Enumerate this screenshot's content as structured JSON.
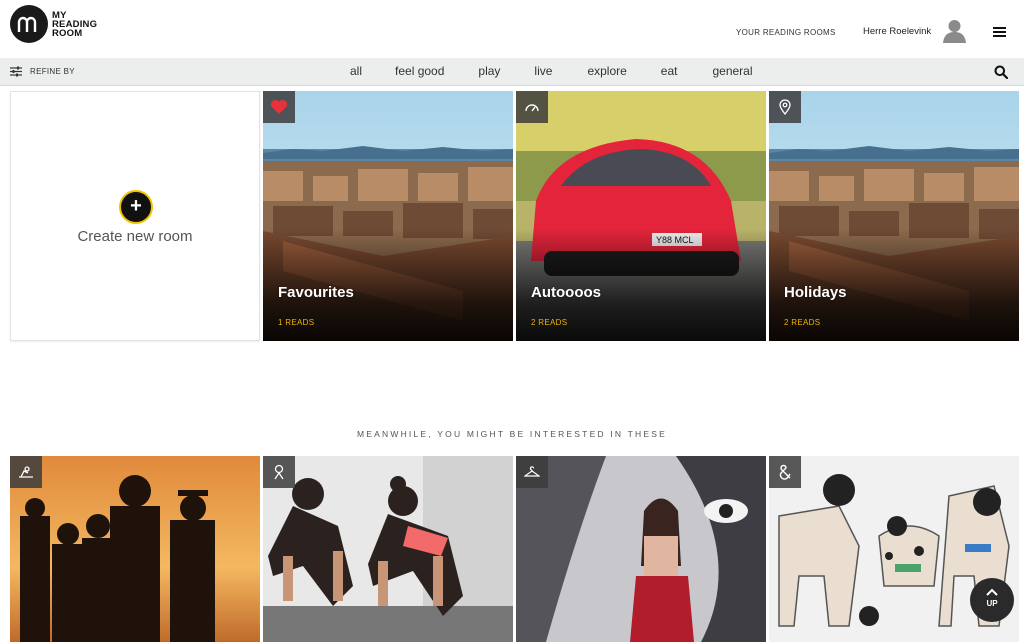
{
  "header": {
    "logo": [
      "MY",
      "READING",
      "ROOM"
    ],
    "nav_link": "YOUR READING ROOMS",
    "user_name": "Herre Roelevink"
  },
  "filterbar": {
    "refine_label": "REFINE BY",
    "categories": [
      "all",
      "feel good",
      "play",
      "live",
      "explore",
      "eat",
      "general"
    ]
  },
  "create_room": {
    "label": "Create new room",
    "icon": "plus-icon"
  },
  "rooms": [
    {
      "title": "Favourites",
      "reads": "1 READS",
      "icon": "heart-icon"
    },
    {
      "title": "Autoooos",
      "reads": "2 READS",
      "icon": "speedometer-icon"
    },
    {
      "title": "Holidays",
      "reads": "2 READS",
      "icon": "map-pin-icon"
    }
  ],
  "suggestions": {
    "title": "MEANWHILE, YOU MIGHT BE INTERESTED IN THESE",
    "items": [
      {
        "icon": "relax-icon"
      },
      {
        "icon": "fitness-icon"
      },
      {
        "icon": "hanger-icon"
      },
      {
        "icon": "ampersand-icon"
      }
    ]
  },
  "up_button": {
    "label": "UP"
  },
  "colors": {
    "accent": "#f2c300",
    "reads": "#f0b400",
    "heart": "#e8313a"
  }
}
